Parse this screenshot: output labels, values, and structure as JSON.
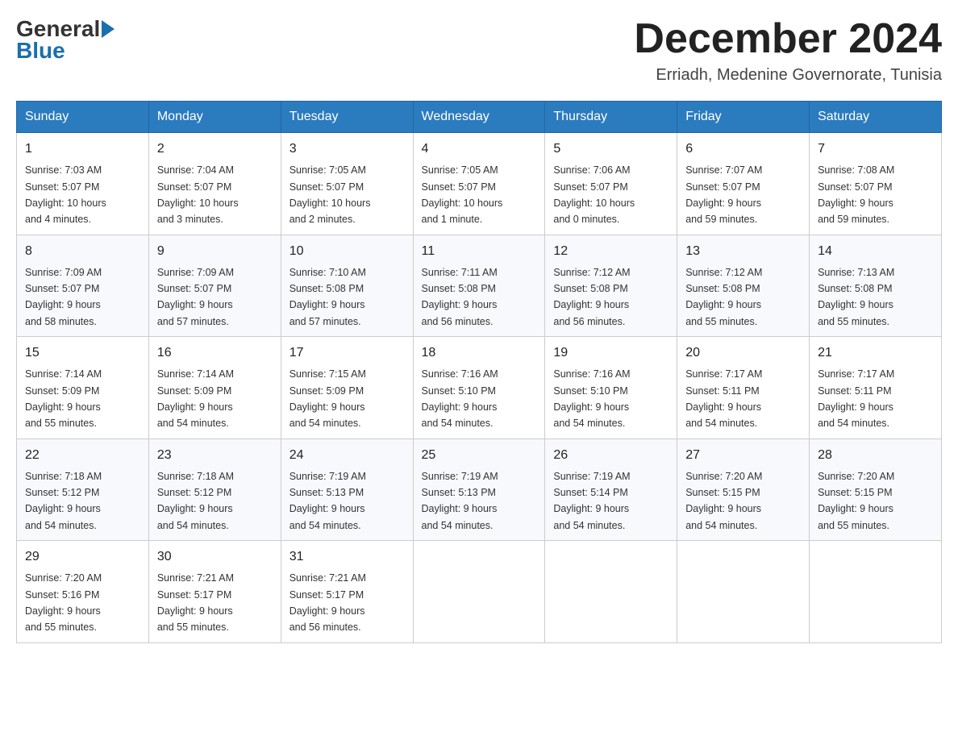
{
  "logo": {
    "general": "General",
    "blue": "Blue"
  },
  "header": {
    "month_year": "December 2024",
    "location": "Erriadh, Medenine Governorate, Tunisia"
  },
  "days_of_week": [
    "Sunday",
    "Monday",
    "Tuesday",
    "Wednesday",
    "Thursday",
    "Friday",
    "Saturday"
  ],
  "weeks": [
    [
      {
        "day": "1",
        "sunrise": "7:03 AM",
        "sunset": "5:07 PM",
        "daylight": "10 hours and 4 minutes."
      },
      {
        "day": "2",
        "sunrise": "7:04 AM",
        "sunset": "5:07 PM",
        "daylight": "10 hours and 3 minutes."
      },
      {
        "day": "3",
        "sunrise": "7:05 AM",
        "sunset": "5:07 PM",
        "daylight": "10 hours and 2 minutes."
      },
      {
        "day": "4",
        "sunrise": "7:05 AM",
        "sunset": "5:07 PM",
        "daylight": "10 hours and 1 minute."
      },
      {
        "day": "5",
        "sunrise": "7:06 AM",
        "sunset": "5:07 PM",
        "daylight": "10 hours and 0 minutes."
      },
      {
        "day": "6",
        "sunrise": "7:07 AM",
        "sunset": "5:07 PM",
        "daylight": "9 hours and 59 minutes."
      },
      {
        "day": "7",
        "sunrise": "7:08 AM",
        "sunset": "5:07 PM",
        "daylight": "9 hours and 59 minutes."
      }
    ],
    [
      {
        "day": "8",
        "sunrise": "7:09 AM",
        "sunset": "5:07 PM",
        "daylight": "9 hours and 58 minutes."
      },
      {
        "day": "9",
        "sunrise": "7:09 AM",
        "sunset": "5:07 PM",
        "daylight": "9 hours and 57 minutes."
      },
      {
        "day": "10",
        "sunrise": "7:10 AM",
        "sunset": "5:08 PM",
        "daylight": "9 hours and 57 minutes."
      },
      {
        "day": "11",
        "sunrise": "7:11 AM",
        "sunset": "5:08 PM",
        "daylight": "9 hours and 56 minutes."
      },
      {
        "day": "12",
        "sunrise": "7:12 AM",
        "sunset": "5:08 PM",
        "daylight": "9 hours and 56 minutes."
      },
      {
        "day": "13",
        "sunrise": "7:12 AM",
        "sunset": "5:08 PM",
        "daylight": "9 hours and 55 minutes."
      },
      {
        "day": "14",
        "sunrise": "7:13 AM",
        "sunset": "5:08 PM",
        "daylight": "9 hours and 55 minutes."
      }
    ],
    [
      {
        "day": "15",
        "sunrise": "7:14 AM",
        "sunset": "5:09 PM",
        "daylight": "9 hours and 55 minutes."
      },
      {
        "day": "16",
        "sunrise": "7:14 AM",
        "sunset": "5:09 PM",
        "daylight": "9 hours and 54 minutes."
      },
      {
        "day": "17",
        "sunrise": "7:15 AM",
        "sunset": "5:09 PM",
        "daylight": "9 hours and 54 minutes."
      },
      {
        "day": "18",
        "sunrise": "7:16 AM",
        "sunset": "5:10 PM",
        "daylight": "9 hours and 54 minutes."
      },
      {
        "day": "19",
        "sunrise": "7:16 AM",
        "sunset": "5:10 PM",
        "daylight": "9 hours and 54 minutes."
      },
      {
        "day": "20",
        "sunrise": "7:17 AM",
        "sunset": "5:11 PM",
        "daylight": "9 hours and 54 minutes."
      },
      {
        "day": "21",
        "sunrise": "7:17 AM",
        "sunset": "5:11 PM",
        "daylight": "9 hours and 54 minutes."
      }
    ],
    [
      {
        "day": "22",
        "sunrise": "7:18 AM",
        "sunset": "5:12 PM",
        "daylight": "9 hours and 54 minutes."
      },
      {
        "day": "23",
        "sunrise": "7:18 AM",
        "sunset": "5:12 PM",
        "daylight": "9 hours and 54 minutes."
      },
      {
        "day": "24",
        "sunrise": "7:19 AM",
        "sunset": "5:13 PM",
        "daylight": "9 hours and 54 minutes."
      },
      {
        "day": "25",
        "sunrise": "7:19 AM",
        "sunset": "5:13 PM",
        "daylight": "9 hours and 54 minutes."
      },
      {
        "day": "26",
        "sunrise": "7:19 AM",
        "sunset": "5:14 PM",
        "daylight": "9 hours and 54 minutes."
      },
      {
        "day": "27",
        "sunrise": "7:20 AM",
        "sunset": "5:15 PM",
        "daylight": "9 hours and 54 minutes."
      },
      {
        "day": "28",
        "sunrise": "7:20 AM",
        "sunset": "5:15 PM",
        "daylight": "9 hours and 55 minutes."
      }
    ],
    [
      {
        "day": "29",
        "sunrise": "7:20 AM",
        "sunset": "5:16 PM",
        "daylight": "9 hours and 55 minutes."
      },
      {
        "day": "30",
        "sunrise": "7:21 AM",
        "sunset": "5:17 PM",
        "daylight": "9 hours and 55 minutes."
      },
      {
        "day": "31",
        "sunrise": "7:21 AM",
        "sunset": "5:17 PM",
        "daylight": "9 hours and 56 minutes."
      },
      null,
      null,
      null,
      null
    ]
  ],
  "labels": {
    "sunrise": "Sunrise:",
    "sunset": "Sunset:",
    "daylight": "Daylight:"
  }
}
